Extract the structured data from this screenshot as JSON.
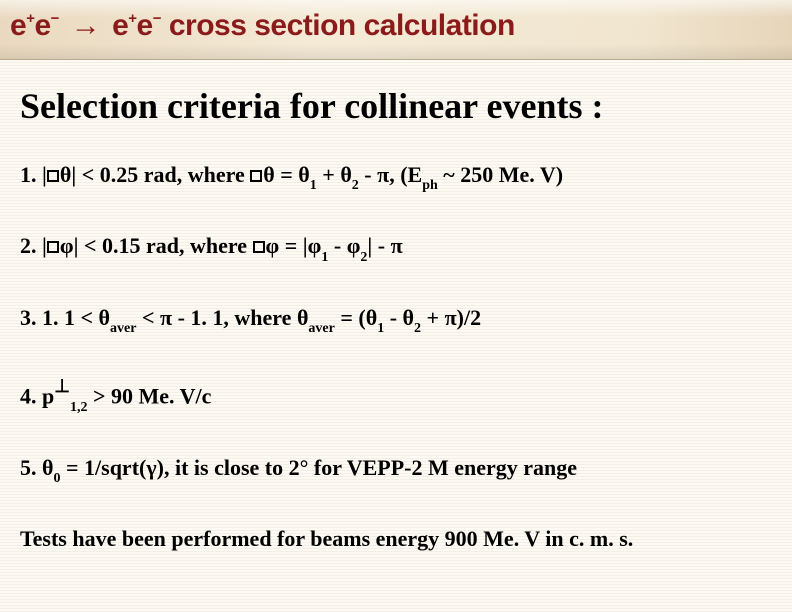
{
  "title": {
    "lhs_e1": "e",
    "lhs_s1": "+",
    "lhs_e2": "e",
    "lhs_s2": "−",
    "arrow": "→",
    "rhs_e1": "e",
    "rhs_s1": "+",
    "rhs_e2": "e",
    "rhs_s2": "−",
    "rest": " cross section calculation"
  },
  "section_title": "Selection criteria for collinear events :",
  "items": {
    "i1": {
      "num": "1. |",
      "theta1": "θ",
      "after1": "| < 0.25 rad, where ",
      "theta2": "θ",
      "eq": " = ",
      "th_a": "θ",
      "sub_a": "1",
      "plus": " + ",
      "th_b": "θ",
      "sub_b": "2",
      "minus": " - ",
      "pi": "π",
      "tail1": ", (E",
      "sub_ph": "ph",
      "tail2": " ~ 250 Me. V)"
    },
    "i2": {
      "num": "2. |",
      "phi1": "φ",
      "after1": "| < 0.15 rad, where ",
      "phi2": "φ",
      "eq": " = |",
      "ph_a": "φ",
      "sub_a": "1",
      "minus1": " - ",
      "ph_b": "φ",
      "sub_b": "2",
      "bar": "| - ",
      "pi": "π"
    },
    "i3": {
      "num": "3. 1. 1 < ",
      "th1": "θ",
      "sub1": "aver",
      "mid1": " < ",
      "pi1": "π",
      "mid2": " - 1. 1, where ",
      "th2": "θ",
      "sub2": "aver",
      "eq": "  = (",
      "th_a": "θ",
      "sub_a": "1",
      "minus": " - ",
      "th_b": "θ",
      "sub_b": "2",
      "plus": " + ",
      "pi2": "π",
      "tail": ")/2"
    },
    "i4": {
      "num": "4. p",
      "perp": "⊥",
      "sub": "1,2",
      "tail": "  > 90 Me. V/c"
    },
    "i5": {
      "num": "5. ",
      "th": "θ",
      "sub": "0",
      "mid": " = 1/sqrt(",
      "gamma": "γ",
      "tail": "),  it is close to 2° for VEPP-2 M energy range"
    },
    "final": "Tests have been performed for beams energy 900 Me. V in c. m. s."
  }
}
